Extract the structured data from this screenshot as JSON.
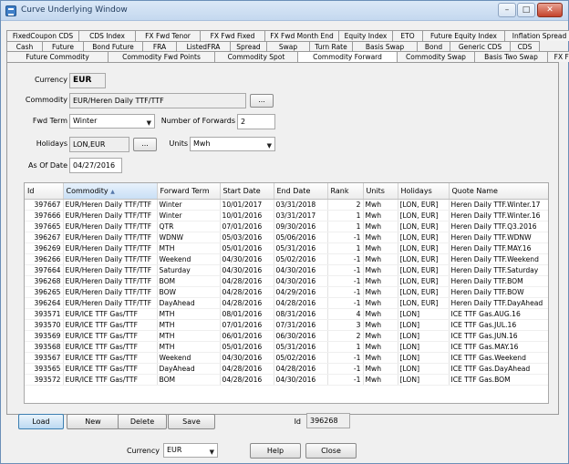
{
  "window": {
    "title": "Curve Underlying Window",
    "minimize": "–",
    "maximize": "□",
    "close": "✕"
  },
  "tabs": {
    "row1": [
      "FixedCoupon CDS",
      "CDS Index",
      "FX Fwd Tenor",
      "FX Fwd Fixed",
      "FX Fwd Month End",
      "Equity Index",
      "ETO",
      "Future Equity Index",
      "Inflation Spread"
    ],
    "row2": [
      "Cash",
      "Future",
      "Bond Future",
      "FRA",
      "ListedFRA",
      "Spread",
      "Swap",
      "Turn Rate",
      "Basis Swap",
      "Bond",
      "Generic CDS",
      "CDS"
    ],
    "row3": [
      "Future Commodity",
      "Commodity Fwd Points",
      "Commodity Spot",
      "Commodity Forward",
      "Commodity Swap",
      "Basis Two Swap",
      "FX Future"
    ],
    "selected": "Commodity Forward"
  },
  "form": {
    "currency_label": "Currency",
    "currency": "EUR",
    "commodity_label": "Commodity",
    "commodity": "EUR/Heren Daily TTF/TTF",
    "fwd_term_label": "Fwd Term",
    "fwd_term": "Winter",
    "num_forwards_label": "Number of Forwards",
    "num_forwards": "2",
    "holidays_label": "Holidays",
    "holidays": "LON,EUR",
    "units_label": "Units",
    "units": "Mwh",
    "as_of_label": "As Of Date",
    "as_of": "04/27/2016",
    "ellipsis": "..."
  },
  "table": {
    "columns": [
      "Id",
      "Commodity",
      "Forward Term",
      "Start Date",
      "End Date",
      "Rank",
      "Units",
      "Holidays",
      "Quote Name"
    ],
    "sorted_column": "Commodity",
    "rows": [
      [
        "397667",
        "EUR/Heren Daily TTF/TTF",
        "Winter",
        "10/01/2017",
        "03/31/2018",
        "2",
        "Mwh",
        "[LON, EUR]",
        "Heren Daily TTF.Winter.17"
      ],
      [
        "397666",
        "EUR/Heren Daily TTF/TTF",
        "Winter",
        "10/01/2016",
        "03/31/2017",
        "1",
        "Mwh",
        "[LON, EUR]",
        "Heren Daily TTF.Winter.16"
      ],
      [
        "397665",
        "EUR/Heren Daily TTF/TTF",
        "QTR",
        "07/01/2016",
        "09/30/2016",
        "1",
        "Mwh",
        "[LON, EUR]",
        "Heren Daily TTF.Q3.2016"
      ],
      [
        "396267",
        "EUR/Heren Daily TTF/TTF",
        "WDNW",
        "05/03/2016",
        "05/06/2016",
        "-1",
        "Mwh",
        "[LON, EUR]",
        "Heren Daily TTF.WDNW"
      ],
      [
        "396269",
        "EUR/Heren Daily TTF/TTF",
        "MTH",
        "05/01/2016",
        "05/31/2016",
        "1",
        "Mwh",
        "[LON, EUR]",
        "Heren Daily TTF.MAY.16"
      ],
      [
        "396266",
        "EUR/Heren Daily TTF/TTF",
        "Weekend",
        "04/30/2016",
        "05/02/2016",
        "-1",
        "Mwh",
        "[LON, EUR]",
        "Heren Daily TTF.Weekend"
      ],
      [
        "397664",
        "EUR/Heren Daily TTF/TTF",
        "Saturday",
        "04/30/2016",
        "04/30/2016",
        "-1",
        "Mwh",
        "[LON, EUR]",
        "Heren Daily TTF.Saturday"
      ],
      [
        "396268",
        "EUR/Heren Daily TTF/TTF",
        "BOM",
        "04/28/2016",
        "04/30/2016",
        "-1",
        "Mwh",
        "[LON, EUR]",
        "Heren Daily TTF.BOM"
      ],
      [
        "396265",
        "EUR/Heren Daily TTF/TTF",
        "BOW",
        "04/28/2016",
        "04/29/2016",
        "-1",
        "Mwh",
        "[LON, EUR]",
        "Heren Daily TTF.BOW"
      ],
      [
        "396264",
        "EUR/Heren Daily TTF/TTF",
        "DayAhead",
        "04/28/2016",
        "04/28/2016",
        "-1",
        "Mwh",
        "[LON, EUR]",
        "Heren Daily TTF.DayAhead"
      ],
      [
        "393571",
        "EUR/ICE TTF Gas/TTF",
        "MTH",
        "08/01/2016",
        "08/31/2016",
        "4",
        "Mwh",
        "[LON]",
        "ICE TTF Gas.AUG.16"
      ],
      [
        "393570",
        "EUR/ICE TTF Gas/TTF",
        "MTH",
        "07/01/2016",
        "07/31/2016",
        "3",
        "Mwh",
        "[LON]",
        "ICE TTF Gas.JUL.16"
      ],
      [
        "393569",
        "EUR/ICE TTF Gas/TTF",
        "MTH",
        "06/01/2016",
        "06/30/2016",
        "2",
        "Mwh",
        "[LON]",
        "ICE TTF Gas.JUN.16"
      ],
      [
        "393568",
        "EUR/ICE TTF Gas/TTF",
        "MTH",
        "05/01/2016",
        "05/31/2016",
        "1",
        "Mwh",
        "[LON]",
        "ICE TTF Gas.MAY.16"
      ],
      [
        "393567",
        "EUR/ICE TTF Gas/TTF",
        "Weekend",
        "04/30/2016",
        "05/02/2016",
        "-1",
        "Mwh",
        "[LON]",
        "ICE TTF Gas.Weekend"
      ],
      [
        "393565",
        "EUR/ICE TTF Gas/TTF",
        "DayAhead",
        "04/28/2016",
        "04/28/2016",
        "-1",
        "Mwh",
        "[LON]",
        "ICE TTF Gas.DayAhead"
      ],
      [
        "393572",
        "EUR/ICE TTF Gas/TTF",
        "BOM",
        "04/28/2016",
        "04/30/2016",
        "-1",
        "Mwh",
        "[LON]",
        "ICE TTF Gas.BOM"
      ]
    ]
  },
  "actions": {
    "load": "Load",
    "new": "New",
    "delete": "Delete",
    "save": "Save",
    "id_label": "Id",
    "id_value": "396268"
  },
  "footer": {
    "currency_label": "Currency",
    "currency": "EUR",
    "help": "Help",
    "close": "Close"
  },
  "icons": {
    "dropdown": "▼",
    "sort": "▲"
  }
}
